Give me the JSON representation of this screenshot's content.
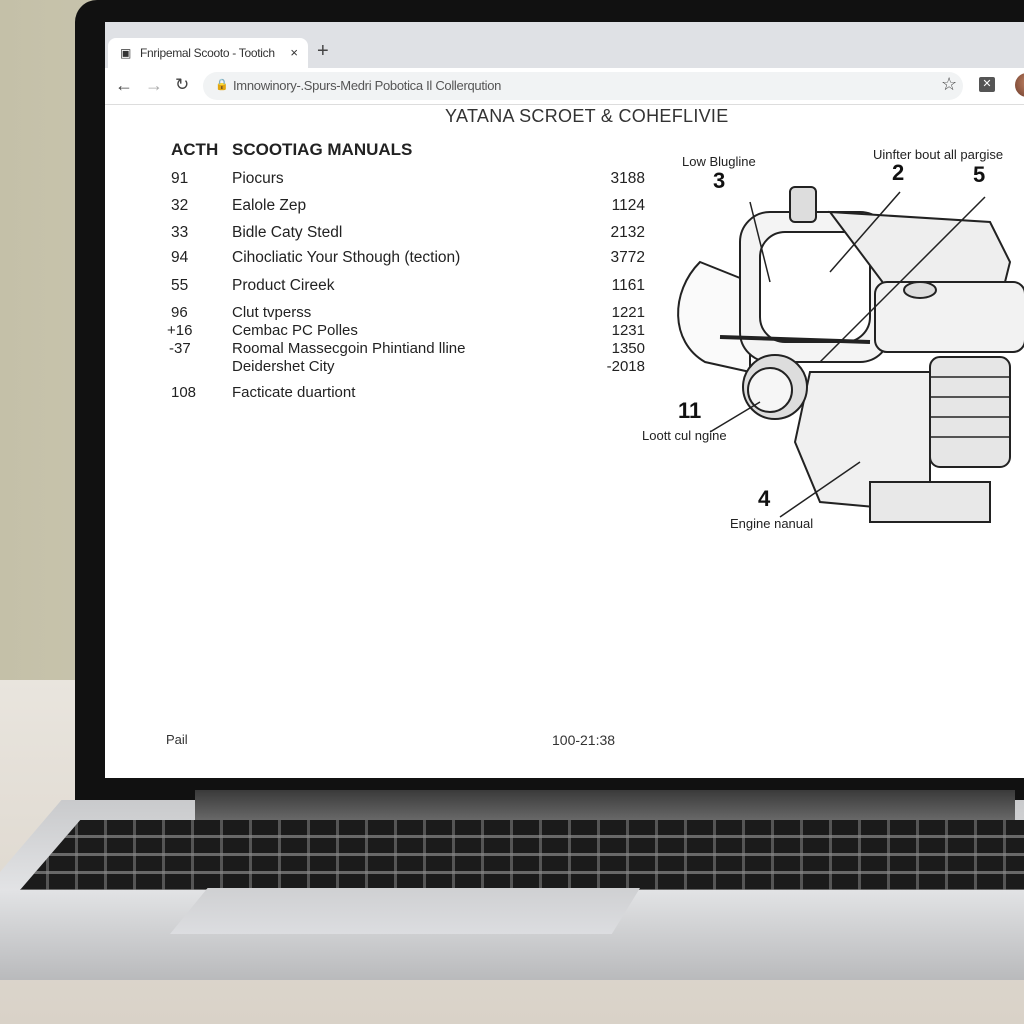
{
  "browser": {
    "tab_title": "Fnripemal Scooto - Tootich",
    "tab_close": "×",
    "new_tab": "+",
    "url": "Imnowinory-.Spurs-Medri Pobotica Il Collerqution",
    "icons": {
      "back": "arrow-left",
      "forward": "arrow-right",
      "reload": "reload",
      "lock": "lock",
      "bookmark": "star",
      "extension": "puzzle",
      "profile": "avatar"
    }
  },
  "page": {
    "brand": "YATANA SCROET & COHEFLIVIE",
    "header": {
      "col1": "ACTH",
      "col2": "SCOOTIAG MANUALS"
    },
    "rows": [
      {
        "num": "91",
        "title": "Piocurs",
        "value": "3188"
      },
      {
        "num": "32",
        "title": "Ealole Zep",
        "value": "1124"
      },
      {
        "num": "33",
        "title": "Bidle Caty Stedl",
        "value": "2132"
      },
      {
        "num": "94",
        "title": "Cihocliatic Your Sthough (tection)",
        "value": "3772"
      },
      {
        "num": "55",
        "title": "Product Cireek",
        "value": "1161"
      },
      {
        "num": "96",
        "title": "Clut tvperss",
        "value": "1221"
      },
      {
        "num": "+16",
        "title": "Cembac PC Polles",
        "value": "1231"
      },
      {
        "num": "-37",
        "title": "Roomal Massecgoin Phintiand lline",
        "value": "1350"
      },
      {
        "num": "",
        "title": "Deidershet City",
        "value": "-2018"
      },
      {
        "num": "108",
        "title": "Facticate duartiont",
        "value": ""
      }
    ],
    "diagram": {
      "labels": {
        "top_left": "Low Blugline",
        "top_right": "Uinfter bout all pargise",
        "left": "Loott cul ngine",
        "bottom": "Engine nanual"
      },
      "callouts": [
        "3",
        "2",
        "5",
        "11",
        "4"
      ]
    },
    "footer": {
      "left": "Pail",
      "right": "100-21:38"
    }
  }
}
